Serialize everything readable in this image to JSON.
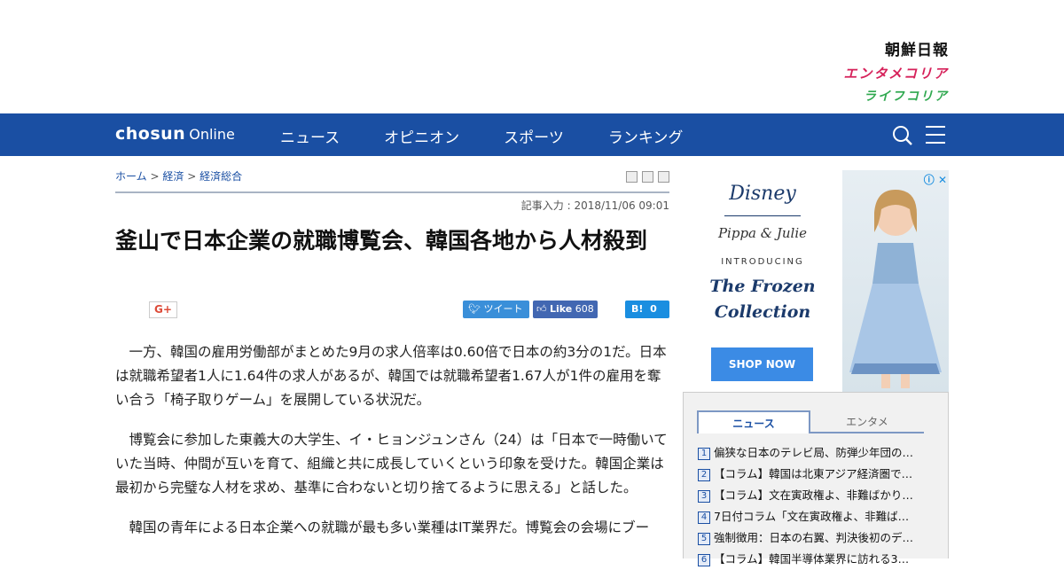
{
  "header": {
    "brands": [
      "朝鮮日報",
      "エンタメコリア",
      "ライフコリア"
    ]
  },
  "nav": {
    "logo_bold": "chosun",
    "logo_light": "Online",
    "items": [
      "ニュース",
      "オピニオン",
      "スポーツ",
      "ランキング"
    ]
  },
  "article": {
    "breadcrumb": [
      "ホーム",
      "経済",
      "経済総合"
    ],
    "breadcrumb_sep": ">",
    "dateline": "記事入力 : 2018/11/06 09:01",
    "headline": "釜山で日本企業の就職博覧会、韓国各地から人材殺到",
    "share": {
      "gplus": "G+",
      "tweet": "ツイート",
      "fb_like": "Like",
      "fb_count": "608",
      "hatena": "B!",
      "hatena_count": "0"
    },
    "paragraphs": [
      "一方、韓国の雇用労働部がまとめた9月の求人倍率は0.60倍で日本の約3分の1だ。日本は就職希望者1人に1.64件の求人があるが、韓国では就職希望者1.67人が1件の雇用を奪い合う「椅子取りゲーム」を展開している状況だ。",
      "博覧会に参加した東義大の大学生、イ・ヒョンジュンさん（24）は「日本で一時働いていた当時、仲間が互いを育て、組織と共に成長していくという印象を受けた。韓国企業は最初から完璧な人材を求め、基準に合わないと切り捨てるように思える」と話した。",
      "韓国の青年による日本企業への就職が最も多い業種はIT業界だ。博覧会の会場にブー"
    ]
  },
  "ad": {
    "brand": "Disney",
    "sub_brand": "Pippa & Julie",
    "intro": "INTRODUCING",
    "title_line1": "The Frozen",
    "title_line2": "Collection",
    "cta": "SHOP NOW",
    "choices": "ⓘ ✕"
  },
  "ranking": {
    "tabs": [
      "ニュース",
      "エンタメ"
    ],
    "items": [
      {
        "num": "1",
        "title": "偏狭な日本のテレビ局、防弾少年団の…"
      },
      {
        "num": "2",
        "title": "【コラム】韓国は北東アジア経済圏で…"
      },
      {
        "num": "3",
        "title": "【コラム】文在寅政権よ、非難ばかり…"
      },
      {
        "num": "4",
        "title": "7日付コラム「文在寅政権よ、非難ば…"
      },
      {
        "num": "5",
        "title": "強制徴用：日本の右翼、判決後初のデ…"
      },
      {
        "num": "6",
        "title": "【コラム】韓国半導体業界に訪れる3…"
      }
    ]
  }
}
